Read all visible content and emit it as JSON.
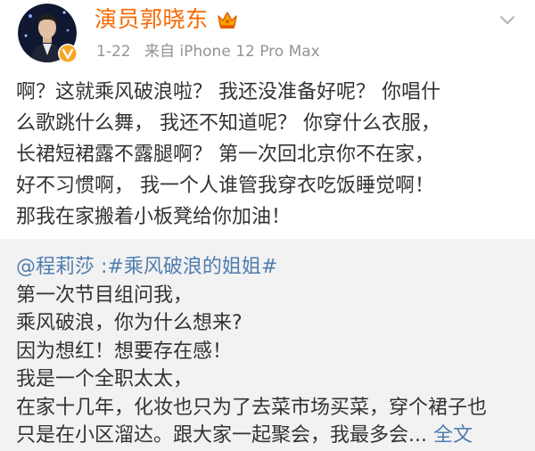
{
  "author": {
    "name": "演员郭晓东",
    "avatar_icon": "avatar-photo",
    "verified_icon": "verified-badge-icon",
    "crown_icon": "crown-vip-icon"
  },
  "meta": {
    "time": "1-22",
    "source_prefix": "来自",
    "source_device": "iPhone 12 Pro Max"
  },
  "menu_icon": "chevron-down-icon",
  "main_text_lines": [
    "啊？这就乘风破浪啦？ 我还没准备好呢？ 你唱什",
    "么歌跳什么舞， 我还不知道呢？ 你穿什么衣服，",
    "长裙短裙露不露腿啊？ 第一次回北京你不在家，",
    "好不习惯啊， 我一个人谁管我穿衣吃饭睡觉啊！",
    "那我在家搬着小板凳给你加油！"
  ],
  "repost": {
    "mention": "@程莉莎",
    "separator": " :",
    "topic": "#乘风破浪的姐姐#",
    "lines": [
      "第一次节目组问我，",
      "乘风破浪，你为什么想来?",
      "因为想红！想要存在感！",
      "我是一个全职太太，",
      "在家十几年，化妆也只为了去菜市场买菜，穿个裙子也"
    ],
    "last_line": "只是在小区溜达。跟大家一起聚会，我最多会...",
    "expand_label": "全文"
  },
  "colors": {
    "author_name": "#f86800",
    "meta": "#939393",
    "text": "#333333",
    "link": "#507daf",
    "repost_bg": "#f2f2f2"
  }
}
